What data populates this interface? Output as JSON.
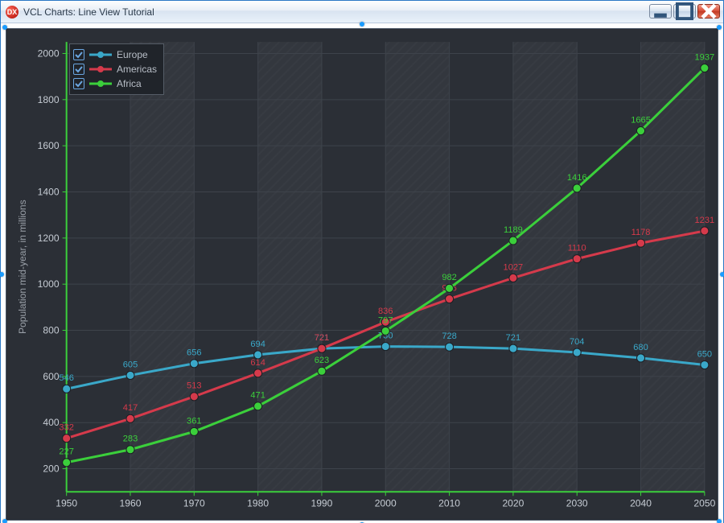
{
  "window": {
    "title": "VCL Charts: Line View Tutorial",
    "app_icon_text": "DX"
  },
  "legend": {
    "items": [
      {
        "label": "Europe",
        "color": "#3aa8c9"
      },
      {
        "label": "Americas",
        "color": "#d53a4b"
      },
      {
        "label": "Africa",
        "color": "#3bcf3b"
      }
    ]
  },
  "axes": {
    "y_label": "Population mid-year, in millions",
    "x_ticks": [
      "1950",
      "1960",
      "1970",
      "1980",
      "1990",
      "2000",
      "2010",
      "2020",
      "2030",
      "2040",
      "2050"
    ],
    "y_ticks": [
      "200",
      "400",
      "600",
      "800",
      "1000",
      "1200",
      "1400",
      "1600",
      "1800",
      "2000"
    ]
  },
  "chart_data": {
    "type": "line",
    "title": "",
    "xlabel": "",
    "ylabel": "Population mid-year, in millions",
    "x": [
      1950,
      1960,
      1970,
      1980,
      1990,
      2000,
      2010,
      2020,
      2030,
      2040,
      2050
    ],
    "ylim": [
      100,
      2050
    ],
    "categories": [
      "1950",
      "1960",
      "1970",
      "1980",
      "1990",
      "2000",
      "2010",
      "2020",
      "2030",
      "2040",
      "2050"
    ],
    "series": [
      {
        "name": "Europe",
        "color": "#3aa8c9",
        "values": [
          546,
          605,
          656,
          694,
          721,
          730,
          728,
          721,
          704,
          680,
          650
        ]
      },
      {
        "name": "Americas",
        "color": "#d53a4b",
        "values": [
          332,
          417,
          513,
          614,
          721,
          836,
          936,
          1027,
          1110,
          1178,
          1231
        ]
      },
      {
        "name": "Africa",
        "color": "#3bcf3b",
        "values": [
          227,
          283,
          361,
          471,
          623,
          797,
          982,
          1189,
          1416,
          1665,
          1937
        ]
      }
    ],
    "value_labels_visible": true,
    "legend_position": "top-left",
    "grid": {
      "major_x": true,
      "major_y": true,
      "interlaced_x": true
    }
  }
}
